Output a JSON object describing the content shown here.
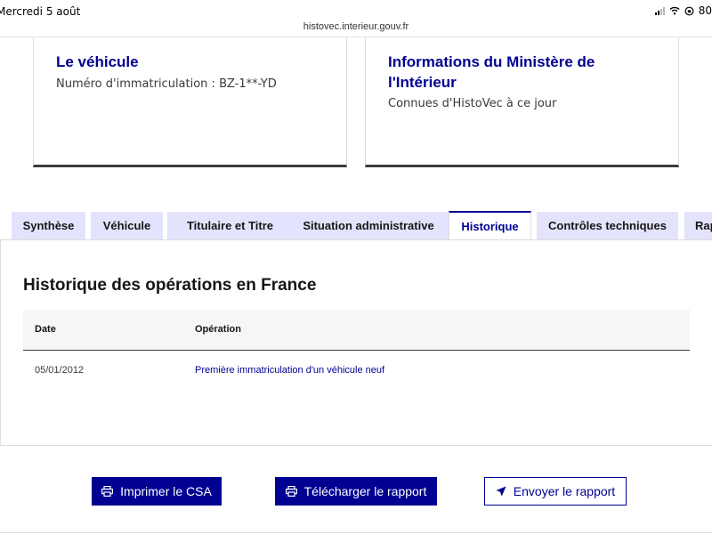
{
  "status_bar": {
    "date": "Mercredi 5 août",
    "battery": "80"
  },
  "browser": {
    "url": "histovec.interieur.gouv.fr"
  },
  "cards": {
    "vehicle": {
      "title": "Le véhicule",
      "text": "Numéro d'immatriculation : BZ-1**-YD"
    },
    "ministry": {
      "title": "Informations du Ministère de l'Intérieur",
      "text": "Connues d'HistoVec à ce jour"
    }
  },
  "tabs": [
    {
      "label": "Synthèse",
      "active": false
    },
    {
      "label": "Véhicule",
      "active": false
    },
    {
      "label": "Titulaire et Titre",
      "active": false
    },
    {
      "label": "Situation administrative",
      "active": false
    },
    {
      "label": "Historique",
      "active": true
    },
    {
      "label": "Contrôles techniques",
      "active": false
    },
    {
      "label": "Rap",
      "active": false
    }
  ],
  "history": {
    "title": "Historique des opérations en France",
    "columns": {
      "date": "Date",
      "operation": "Opération"
    },
    "rows": [
      {
        "date": "05/01/2012",
        "operation": "Première immatriculation d'un véhicule neuf"
      }
    ]
  },
  "actions": {
    "print": "Imprimer le CSA",
    "download": "Télécharger le rapport",
    "send": "Envoyer le rapport"
  },
  "colors": {
    "primary": "#000091",
    "tab_background": "#e3e3fd"
  }
}
